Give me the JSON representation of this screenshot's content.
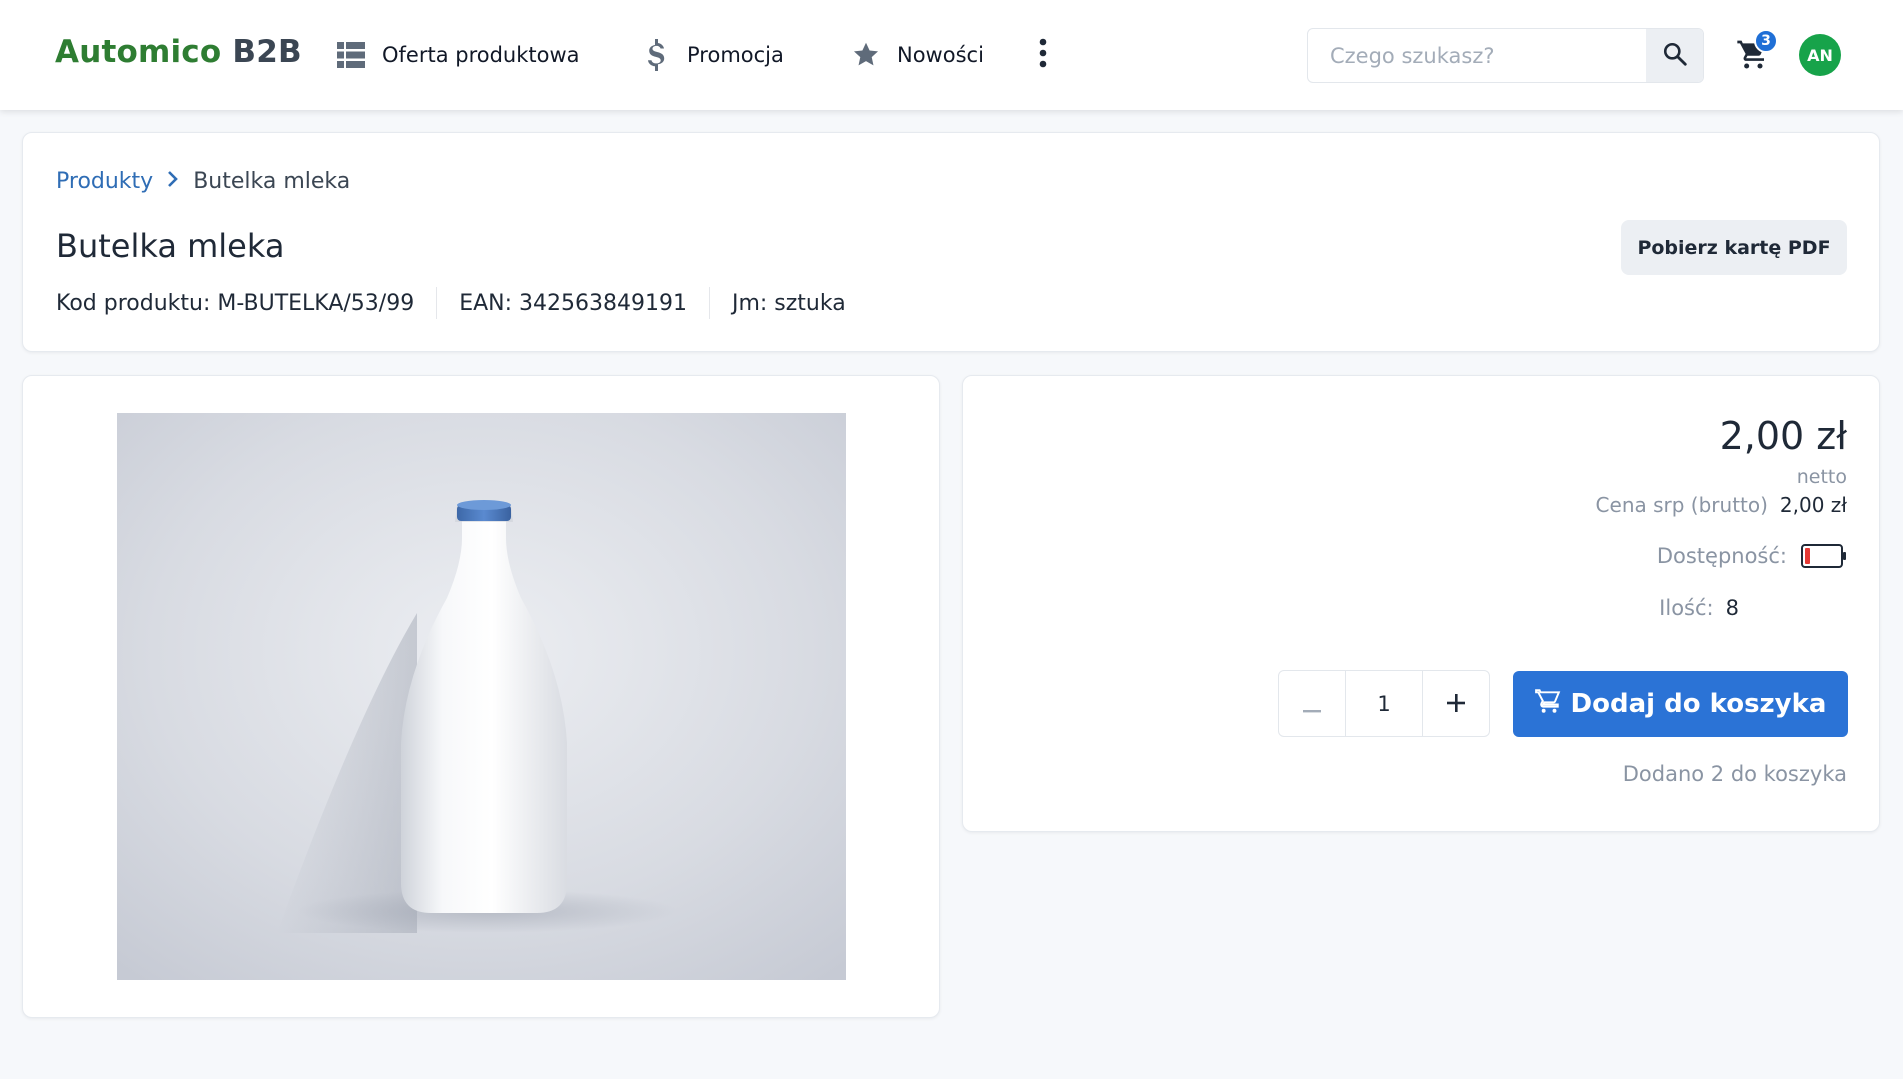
{
  "header": {
    "brand_part1": "Automico",
    "brand_part2": "B2B",
    "nav": [
      {
        "label": "Oferta produktowa",
        "icon": "grid-list-icon"
      },
      {
        "label": "Promocja",
        "icon": "dollar-icon"
      },
      {
        "label": "Nowości",
        "icon": "star-icon"
      }
    ],
    "search_placeholder": "Czego szukasz?",
    "cart_count": "3",
    "avatar_initials": "AN"
  },
  "breadcrumb": {
    "root": "Produkty",
    "current": "Butelka mleka"
  },
  "product": {
    "title": "Butelka mleka",
    "code": "Kod produktu: M-BUTELKA/53/99",
    "ean": "EAN: 342563849191",
    "unit": "Jm: sztuka",
    "pdf_button": "Pobierz kartę PDF"
  },
  "pricing": {
    "price": "2,00 zł",
    "price_type": "netto",
    "srp_label": "Cena srp (brutto)",
    "srp_value": "2,00 zł",
    "availability_label": "Dostępność:",
    "availability_level": 0.15,
    "quantity_label": "Ilość:",
    "quantity_value": "8"
  },
  "purchase": {
    "stepper_value": "1",
    "add_button": "Dodaj do koszyka",
    "added_note": "Dodano 2 do koszyka"
  },
  "colors": {
    "brand_green": "#2e7d32",
    "accent_blue": "#2b73d6",
    "avatar_green": "#17a34a",
    "battery_red": "#e53935"
  }
}
